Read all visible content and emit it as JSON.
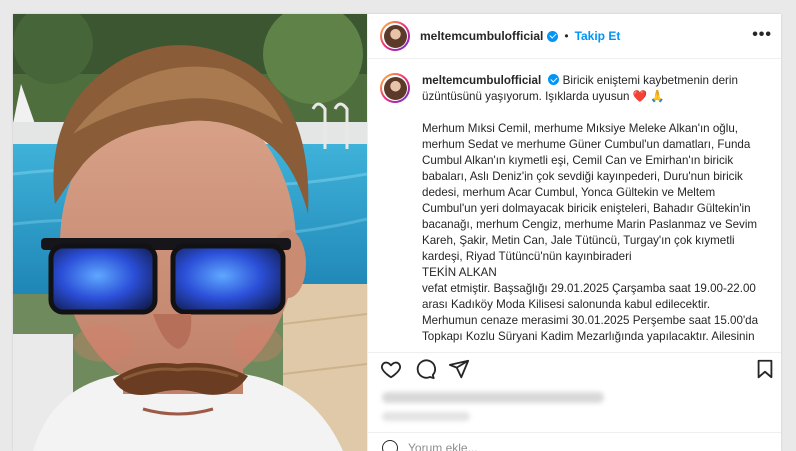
{
  "post": {
    "username": "meltemcumbulofficial",
    "separator": "•",
    "follow_label": "Takip Et",
    "more_label": "•••",
    "caption_intro": "Biricik eniştemi kaybetmenin derin üzüntüsünü yaşıyorum. Işıklarda uyusun",
    "caption_emoji": "❤️ 🙏",
    "caption_body": "Merhum Mıksi Cemil, merhume Mıksiye Meleke Alkan'ın oğlu, merhum Sedat ve merhume Güner Cumbul'un damatları, Funda Cumbul Alkan'ın kıymetli eşi, Cemil Can ve Emirhan'ın biricik babaları, Aslı Deniz'in çok sevdiği kayınpederi, Duru'nun biricik dedesi, merhum Acar Cumbul, Yonca Gültekin ve Meltem Cumbul'un yeri dolmayacak biricik enişteleri, Bahadır Gültekin'in bacanağı, merhum Cengiz, merhume Marin Paslanmaz ve Sevim Kareh, Şakir, Metin Can, Jale Tütüncü, Turgay'ın çok kıymetli kardeşi, Riyad Tütüncü'nün kayınbiraderi\nTEKİN ALKAN\nvefat etmiştir. Başsağlığı 29.01.2025 Çarşamba saat 19.00-22.00 arası Kadıköy Moda Kilisesi salonunda kabul edilecektir.\nMerhumun cenaze merasimi 30.01.2025 Perşembe saat 15.00'da Topkapı Kozlu Süryani Kadim Mezarlığında yapılacaktır. Ailesinin"
  },
  "comment": {
    "placeholder": "Yorum ekle..."
  },
  "icons": {
    "like": "heart-outline-icon",
    "comment": "comment-bubble-icon",
    "share": "paper-plane-icon",
    "save": "bookmark-icon",
    "emoji": "smiley-icon"
  },
  "colors": {
    "accent": "#0095f6",
    "text": "#262626",
    "muted": "#8e8e8e",
    "heart": "#e0245e"
  }
}
